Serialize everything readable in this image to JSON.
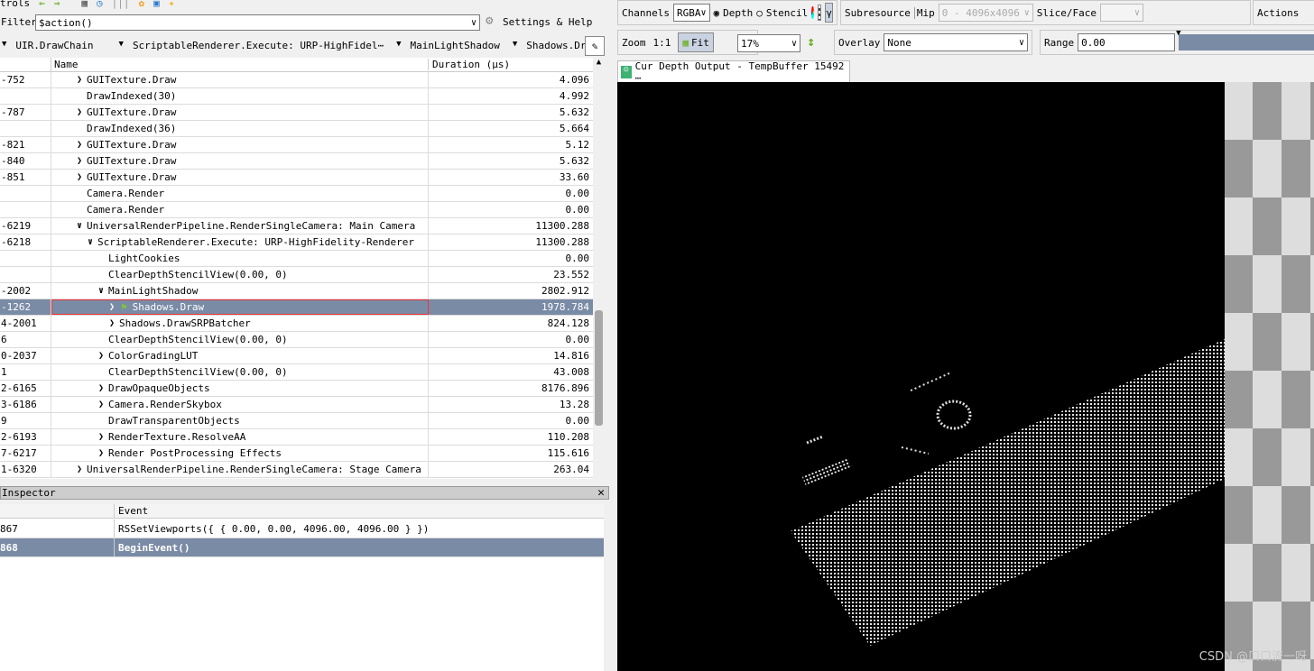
{
  "toolbar": {
    "controls_label": "trols",
    "filter_label": "Filter",
    "filter_value": "$action()",
    "settings_label": "Settings & Help"
  },
  "breadcrumbs": [
    "UIR.DrawChain",
    "ScriptableRenderer.Execute: URP-HighFidel⋯",
    "MainLightShadow",
    "Shadows.Draw"
  ],
  "events": {
    "columns": [
      "Name",
      "Duration (µs)"
    ],
    "rows": [
      {
        "eid": "-752",
        "name": "GUITexture.Draw",
        "depth": 0,
        "expand": "collapsed",
        "duration": "4.096"
      },
      {
        "eid": "",
        "name": "DrawIndexed(30)",
        "depth": 0,
        "expand": "none",
        "duration": "4.992"
      },
      {
        "eid": "-787",
        "name": "GUITexture.Draw",
        "depth": 0,
        "expand": "collapsed",
        "duration": "5.632"
      },
      {
        "eid": "",
        "name": "DrawIndexed(36)",
        "depth": 0,
        "expand": "none",
        "duration": "5.664"
      },
      {
        "eid": "-821",
        "name": "GUITexture.Draw",
        "depth": 0,
        "expand": "collapsed",
        "duration": "5.12"
      },
      {
        "eid": "-840",
        "name": "GUITexture.Draw",
        "depth": 0,
        "expand": "collapsed",
        "duration": "5.632"
      },
      {
        "eid": "-851",
        "name": "GUITexture.Draw",
        "depth": 0,
        "expand": "collapsed",
        "duration": "33.60"
      },
      {
        "eid": "",
        "name": "Camera.Render",
        "depth": 0,
        "expand": "none",
        "duration": "0.00"
      },
      {
        "eid": "",
        "name": "Camera.Render",
        "depth": 0,
        "expand": "none",
        "duration": "0.00"
      },
      {
        "eid": "-6219",
        "name": "UniversalRenderPipeline.RenderSingleCamera: Main Camera",
        "depth": 0,
        "expand": "expanded",
        "duration": "11300.288"
      },
      {
        "eid": "-6218",
        "name": "ScriptableRenderer.Execute: URP-HighFidelity-Renderer",
        "depth": 1,
        "expand": "expanded",
        "duration": "11300.288"
      },
      {
        "eid": "",
        "name": "LightCookies",
        "depth": 2,
        "expand": "none",
        "duration": "0.00"
      },
      {
        "eid": "",
        "name": "ClearDepthStencilView(0.00, 0)",
        "depth": 2,
        "expand": "none",
        "duration": "23.552"
      },
      {
        "eid": "-2002",
        "name": "MainLightShadow",
        "depth": 2,
        "expand": "expanded",
        "duration": "2802.912"
      },
      {
        "eid": "-1262",
        "name": "Shadows.Draw",
        "depth": 3,
        "expand": "collapsed",
        "duration": "1978.784",
        "selected": true,
        "flag": true
      },
      {
        "eid": "4-2001",
        "name": "Shadows.DrawSRPBatcher",
        "depth": 3,
        "expand": "collapsed",
        "duration": "824.128"
      },
      {
        "eid": "6",
        "name": "ClearDepthStencilView(0.00, 0)",
        "depth": 2,
        "expand": "none",
        "duration": "0.00"
      },
      {
        "eid": "0-2037",
        "name": "ColorGradingLUT",
        "depth": 2,
        "expand": "collapsed",
        "duration": "14.816"
      },
      {
        "eid": "1",
        "name": "ClearDepthStencilView(0.00, 0)",
        "depth": 2,
        "expand": "none",
        "duration": "43.008"
      },
      {
        "eid": "2-6165",
        "name": "DrawOpaqueObjects",
        "depth": 2,
        "expand": "collapsed",
        "duration": "8176.896"
      },
      {
        "eid": "3-6186",
        "name": "Camera.RenderSkybox",
        "depth": 2,
        "expand": "collapsed",
        "duration": "13.28"
      },
      {
        "eid": "9",
        "name": "DrawTransparentObjects",
        "depth": 2,
        "expand": "none",
        "duration": "0.00"
      },
      {
        "eid": "2-6193",
        "name": "RenderTexture.ResolveAA",
        "depth": 2,
        "expand": "collapsed",
        "duration": "110.208"
      },
      {
        "eid": "7-6217",
        "name": "Render PostProcessing Effects",
        "depth": 2,
        "expand": "collapsed",
        "duration": "115.616"
      },
      {
        "eid": "1-6320",
        "name": "UniversalRenderPipeline.RenderSingleCamera: Stage Camera",
        "depth": 0,
        "expand": "collapsed",
        "duration": "263.04"
      }
    ]
  },
  "inspector": {
    "title": "Inspector",
    "column": "Event",
    "rows": [
      {
        "eid": "867",
        "event": "RSSetViewports({ { 0.00, 0.00, 4096.00, 4096.00 } })"
      },
      {
        "eid": "868",
        "event": "BeginEvent()",
        "selected": true
      }
    ]
  },
  "texture": {
    "channels_label": "Channels",
    "channels_value": "RGBA",
    "depth_label": "Depth",
    "stencil_label": "Stencil",
    "depth_selected": true,
    "subresource_label": "Subresource",
    "mip_label": "Mip",
    "mip_value": "0 - 4096x4096",
    "slice_label": "Slice/Face",
    "slice_value": "",
    "actions_label": "Actions",
    "zoom_label": "Zoom",
    "zoom_1to1": "1:1",
    "fit_label": "Fit",
    "zoom_value": "17%",
    "overlay_label": "Overlay",
    "overlay_value": "None",
    "range_label": "Range",
    "range_value": "0.00",
    "tab_title": "Cur Depth Output - TempBuffer 15492 ⋯"
  },
  "watermark": "CSDN @口口流一呀",
  "colors": {
    "selection": "#7a8ba6",
    "tab_icon": "#3cb371",
    "flag": "#7fc241"
  }
}
